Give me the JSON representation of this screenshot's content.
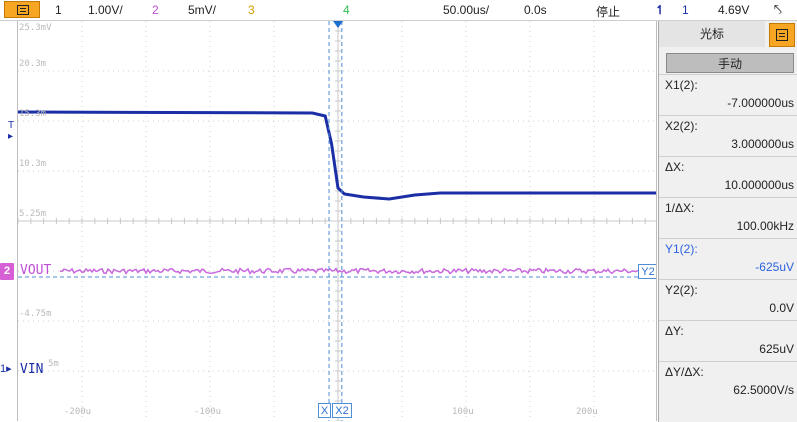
{
  "topbar": {
    "ch1_num": "1",
    "ch1_scale": "1.00V/",
    "ch2_num": "2",
    "ch2_scale": "5mV/",
    "ch3_num": "3",
    "ch4_num": "4",
    "timebase": "50.00us/",
    "delay": "0.0s",
    "run_state": "停止",
    "trigger_source": "1",
    "trigger_level": "4.69V"
  },
  "colors": {
    "ch1": "#1b2ea6",
    "ch2": "#c14fd8",
    "ch3": "#d49a00",
    "ch4": "#2fbf4f",
    "cursor": "#4e8ed6",
    "menu_button": "#f6a623"
  },
  "plot": {
    "y_ticks": [
      "25.3mV",
      "20.3m",
      "15.3m",
      "10.3m",
      "5.25m",
      "-4.75m",
      "5m"
    ],
    "x_ticks": [
      "-200u",
      "-100u",
      "100u",
      "200u"
    ],
    "ch2_label": "VOUT",
    "ch1_label": "VIN",
    "ch2_marker": "2",
    "ch1_marker": "1",
    "trigger_marker": "T",
    "cursor_x1_tag": "X",
    "cursor_x2_tag": "X2",
    "cursor_y2_tag": "Y2"
  },
  "chart_data": {
    "type": "line",
    "x_unit": "us",
    "xlim": [
      -250,
      250
    ],
    "series": [
      {
        "name": "1",
        "points": [
          [
            -250,
            17.2
          ],
          [
            -20,
            17.1
          ],
          [
            -10,
            16.8
          ],
          [
            -5,
            14.0
          ],
          [
            0,
            9.6
          ],
          [
            5,
            9.0
          ],
          [
            10,
            8.9
          ],
          [
            20,
            8.7
          ],
          [
            40,
            8.5
          ],
          [
            60,
            8.9
          ],
          [
            80,
            9.1
          ],
          [
            250,
            9.1
          ]
        ]
      },
      {
        "name": "2",
        "points": [
          [
            -250,
            0.0
          ],
          [
            250,
            0.0
          ]
        ]
      }
    ]
  },
  "panel": {
    "title": "光标",
    "mode": "手动",
    "fields": [
      {
        "label": "X1(2):",
        "value": "-7.000000us",
        "color": "#222222"
      },
      {
        "label": "X2(2):",
        "value": "3.000000us",
        "color": "#222222"
      },
      {
        "label": "ΔX:",
        "value": "10.000000us",
        "color": "#222222"
      },
      {
        "label": "1/ΔX:",
        "value": "100.00kHz",
        "color": "#222222"
      },
      {
        "label": "Y1(2):",
        "value": "-625uV",
        "color": "#2a62e0"
      },
      {
        "label": "Y2(2):",
        "value": "0.0V",
        "color": "#222222"
      },
      {
        "label": "ΔY:",
        "value": "625uV",
        "color": "#222222"
      },
      {
        "label": "ΔY/ΔX:",
        "value": "62.5000V/s",
        "color": "#222222"
      }
    ]
  }
}
